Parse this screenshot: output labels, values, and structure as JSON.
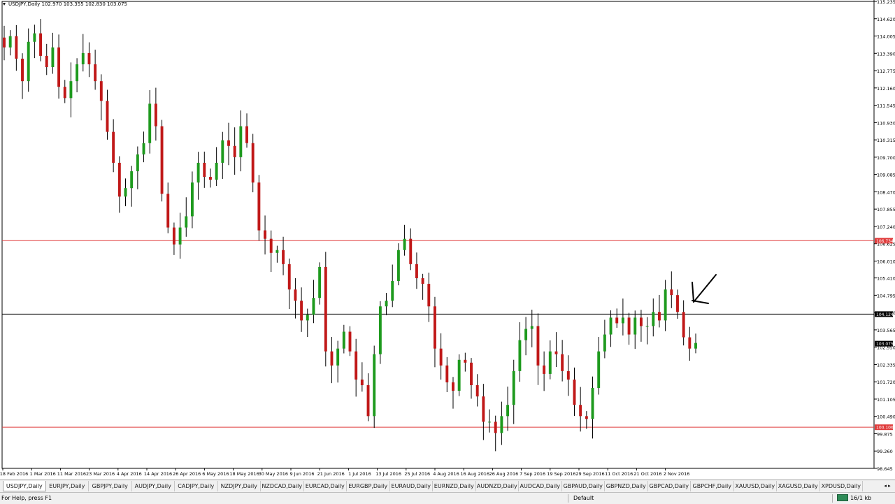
{
  "chart_title": "USDJPY,Daily  102.970 103.355 102.830 103.075",
  "colors": {
    "bull": "#1e9a1e",
    "bear": "#c01818",
    "wick": "#000000",
    "support_resistance": "#e03c3c",
    "midline": "#000000",
    "label_red_bg": "#e03c3c",
    "label_black_bg": "#000000"
  },
  "chart_data": {
    "type": "candlestick",
    "symbol": "USDJPY",
    "timeframe": "Daily",
    "ohlc_header": {
      "open": 102.97,
      "high": 103.355,
      "low": 102.83,
      "close": 103.075
    },
    "price_axis_range": [
      98.645,
      115.235
    ],
    "price_ticks": [
      "115.235",
      "114.620",
      "114.005",
      "113.390",
      "112.775",
      "112.160",
      "111.545",
      "110.930",
      "110.315",
      "109.700",
      "109.085",
      "108.470",
      "107.855",
      "107.240",
      "106.625",
      "106.010",
      "105.410",
      "104.795",
      "104.180",
      "103.565",
      "102.950",
      "102.335",
      "101.720",
      "101.105",
      "100.490",
      "99.875",
      "99.260",
      "98.645"
    ],
    "horizontal_lines": [
      {
        "price": 106.734,
        "color": "red",
        "label": "106.734"
      },
      {
        "price": 104.124,
        "color": "black",
        "label": "104.124"
      },
      {
        "price": 100.106,
        "color": "red",
        "label": "100.106"
      }
    ],
    "current_price_label": "103.075",
    "date_labels": [
      "18 Feb 2016",
      "1 Mar 2016",
      "11 Mar 2016",
      "23 Mar 2016",
      "4 Apr 2016",
      "14 Apr 2016",
      "26 Apr 2016",
      "6 May 2016",
      "18 May 2016",
      "30 May 2016",
      "9 Jun 2016",
      "21 Jun 2016",
      "1 Jul 2016",
      "13 Jul 2016",
      "25 Jul 2016",
      "4 Aug 2016",
      "16 Aug 2016",
      "26 Aug 2016",
      "7 Sep 2016",
      "19 Sep 2016",
      "29 Sep 2016",
      "11 Oct 2016",
      "21 Oct 2016",
      "2 Nov 2016"
    ],
    "close_path": [
      113.6,
      114.0,
      113.2,
      112.4,
      113.8,
      114.1,
      113.3,
      112.9,
      113.6,
      112.2,
      111.8,
      112.4,
      113.0,
      113.4,
      113.0,
      112.4,
      111.7,
      110.6,
      109.5,
      108.3,
      108.6,
      109.2,
      109.8,
      110.2,
      111.6,
      110.8,
      108.4,
      107.2,
      106.6,
      107.2,
      107.6,
      108.8,
      109.5,
      109.0,
      108.9,
      109.5,
      110.3,
      110.1,
      109.7,
      110.8,
      110.2,
      108.8,
      107.1,
      106.8,
      106.3,
      106.4,
      105.9,
      105.0,
      104.6,
      103.9,
      104.1,
      104.7,
      105.8,
      102.8,
      102.3,
      102.9,
      103.5,
      102.8,
      101.8,
      101.6,
      100.5,
      102.7,
      104.4,
      104.6,
      105.3,
      106.4,
      106.8,
      105.9,
      105.4,
      105.2,
      104.4,
      102.9,
      102.3,
      101.7,
      101.4,
      102.5,
      102.4,
      101.6,
      101.2,
      100.3,
      100.3,
      99.9,
      100.5,
      100.9,
      102.1,
      103.2,
      103.6,
      103.7,
      102.3,
      102.0,
      102.8,
      102.7,
      102.1,
      101.8,
      100.9,
      100.5,
      100.4,
      101.5,
      102.8,
      103.4,
      104.0,
      103.8,
      104.0,
      103.4,
      104.0,
      103.7,
      103.7,
      104.2,
      103.9,
      105.0,
      104.8,
      104.2,
      103.3,
      102.9,
      103.1
    ],
    "annotation": "hand-drawn checkmark pointing at recent swing high"
  },
  "tabs": [
    "USDJPY,Daily",
    "EURJPY,Daily",
    "GBPJPY,Daily",
    "AUDJPY,Daily",
    "CADJPY,Daily",
    "NZDJPY,Daily",
    "NZDCAD,Daily",
    "EURCAD,Daily",
    "EURGBP,Daily",
    "EURAUD,Daily",
    "EURNZD,Daily",
    "AUDNZD,Daily",
    "AUDCAD,Daily",
    "GBPAUD,Daily",
    "GBPNZD,Daily",
    "GBPCAD,Daily",
    "GBPCHF,Daily",
    "XAUUSD,Daily",
    "XAGUSD,Daily",
    "XPDUSD,Daily"
  ],
  "active_tab": 0,
  "tab_nav": "◂ ▸",
  "status": {
    "help": "For Help, press F1",
    "profile": "Default",
    "connection": "16/1 kb"
  }
}
